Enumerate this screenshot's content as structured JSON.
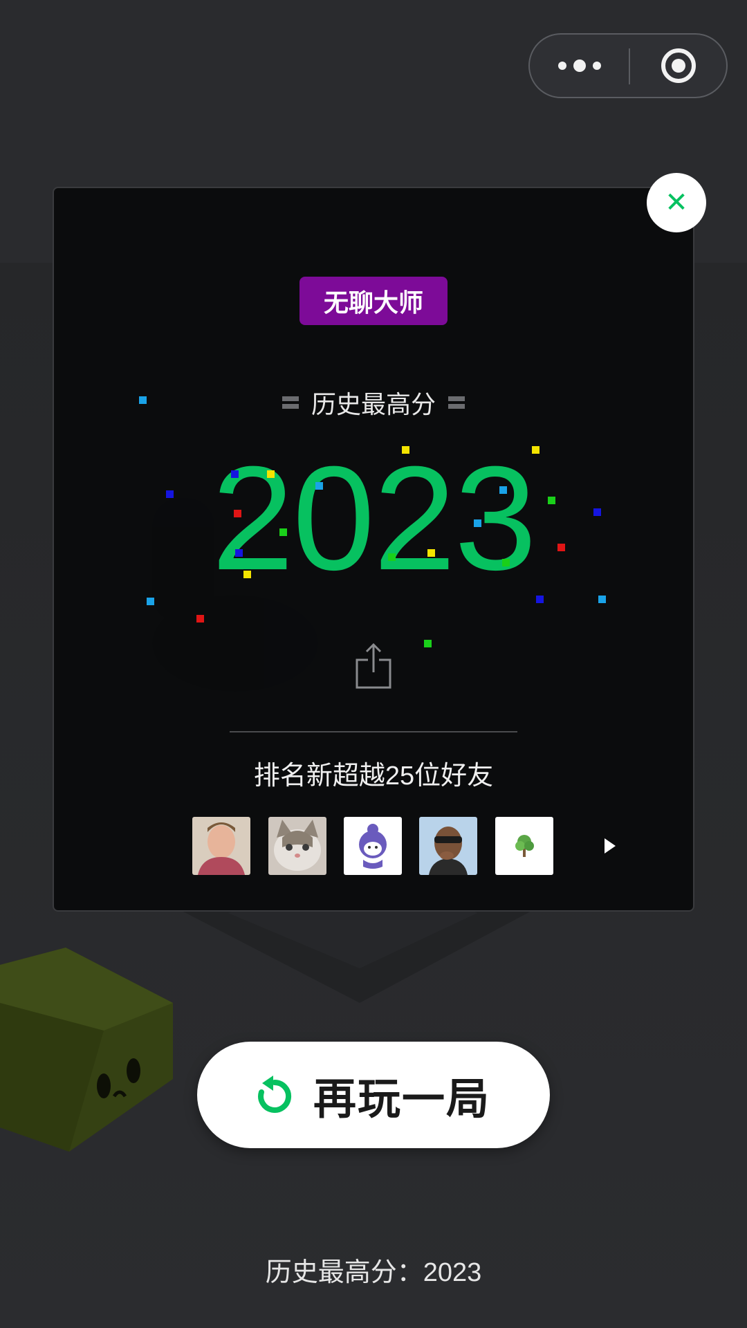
{
  "title_badge": "无聊大师",
  "best_label": "历史最高分",
  "score": "2023",
  "rank_text": "排名新超越25位好友",
  "friends": [
    {
      "name": "friend-1"
    },
    {
      "name": "friend-2"
    },
    {
      "name": "friend-3"
    },
    {
      "name": "friend-4"
    },
    {
      "name": "friend-5"
    }
  ],
  "play_again_label": "再玩一局",
  "footer_text": "历史最高分：2023",
  "icons": {
    "close": "close-icon",
    "share": "share-icon",
    "more": "more-icon",
    "mini_close": "exit-icon",
    "replay": "replay-icon",
    "next": "chevron-right-icon"
  },
  "colors": {
    "accent": "#07c160",
    "badge": "#7d0b98",
    "background": "#2a2b2e"
  }
}
